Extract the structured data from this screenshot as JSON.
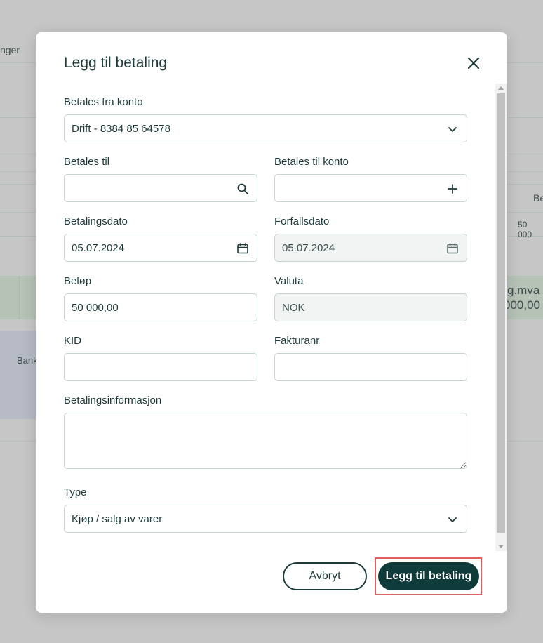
{
  "background": {
    "header_fragment": "nger",
    "col_fragment": "Be",
    "amount_fragment": "50 000",
    "mva_label": "g.mva",
    "mva_amount": "000,00",
    "bank_fragment": "Bank"
  },
  "modal": {
    "title": "Legg til betaling",
    "close_icon": "close-icon",
    "fields": {
      "from_account": {
        "label": "Betales fra konto",
        "value": "Drift - 8384 85 64578"
      },
      "pay_to": {
        "label": "Betales til",
        "value": ""
      },
      "pay_to_account": {
        "label": "Betales til konto",
        "value": ""
      },
      "payment_date": {
        "label": "Betalingsdato",
        "value": "05.07.2024"
      },
      "due_date": {
        "label": "Forfallsdato",
        "value": "05.07.2024"
      },
      "amount": {
        "label": "Beløp",
        "value": "50 000,00"
      },
      "currency": {
        "label": "Valuta",
        "value": "NOK"
      },
      "kid": {
        "label": "KID",
        "value": ""
      },
      "invoice_no": {
        "label": "Fakturanr",
        "value": ""
      },
      "payment_info": {
        "label": "Betalingsinformasjon",
        "value": ""
      },
      "type": {
        "label": "Type",
        "value": "Kjøp / salg av varer"
      }
    },
    "buttons": {
      "cancel": "Avbryt",
      "submit": "Legg til betaling"
    },
    "colors": {
      "primary": "#0f3b3b",
      "highlight": "#e06060"
    }
  }
}
